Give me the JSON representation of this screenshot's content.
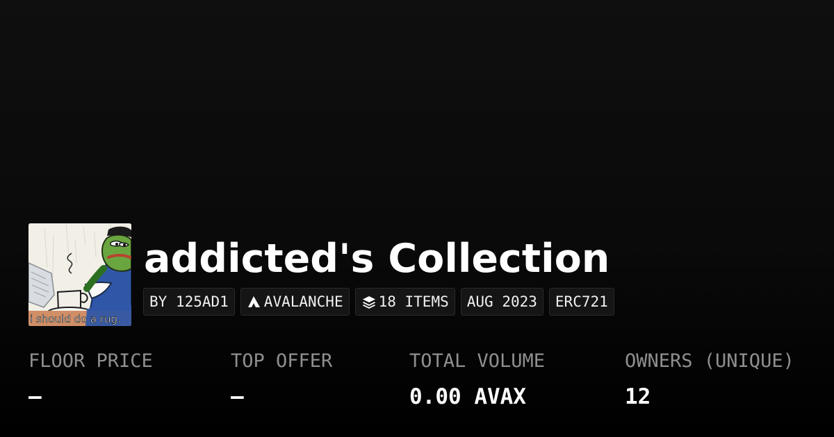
{
  "collection": {
    "name": "addicted's Collection",
    "avatar_caption": "i should do a rug.",
    "avatar_description": "Frog character in a blue suit with a coffee cup and newspaper",
    "tags": {
      "creator": "BY 125AD1",
      "network": "AVALANCHE",
      "items": "18 ITEMS",
      "date": "AUG 2023",
      "standard": "ERC721"
    },
    "icons": {
      "network": "avalanche-icon",
      "items": "layers-icon"
    }
  },
  "stats": {
    "floor_price": {
      "label": "FLOOR PRICE",
      "value": "—"
    },
    "top_offer": {
      "label": "TOP OFFER",
      "value": "—"
    },
    "total_volume": {
      "label": "TOTAL VOLUME",
      "value": "0.00 AVAX"
    },
    "owners": {
      "label": "OWNERS (UNIQUE)",
      "value": "12"
    }
  },
  "colors": {
    "background": "#0a0a0a",
    "text_primary": "#ffffff",
    "text_muted": "#8f8f8f",
    "tag_background": "#151515",
    "tag_border": "#2a2a2a",
    "avatar_green": "#5f9b39",
    "avatar_suit": "#2e58a8"
  }
}
